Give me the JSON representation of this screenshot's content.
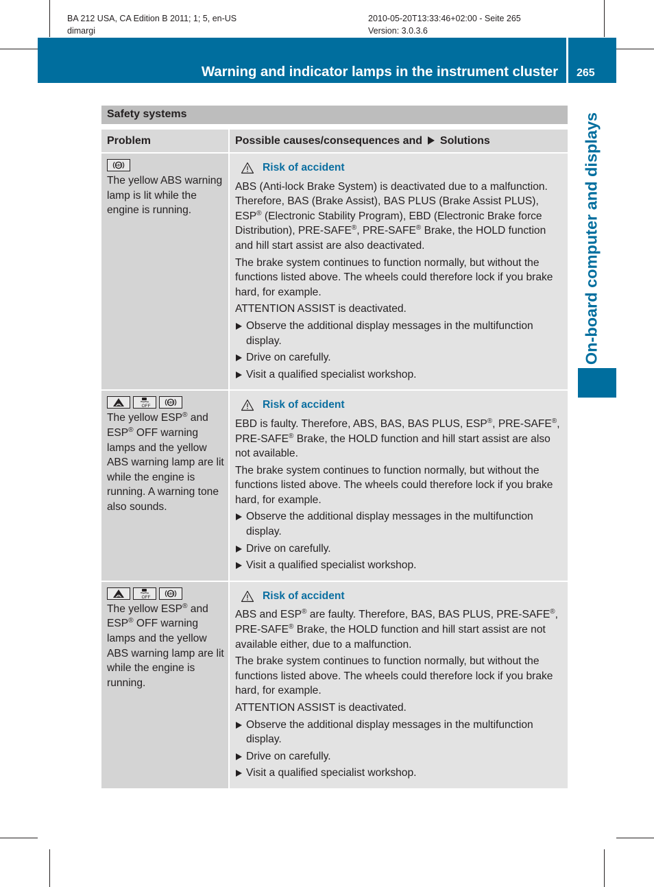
{
  "meta": {
    "left_line1": "BA 212 USA, CA Edition B 2011; 1; 5, en-US",
    "left_line2": "dimargi",
    "right_line1": "2010-05-20T13:33:46+02:00 - Seite 265",
    "right_line2": "Version: 3.0.3.6"
  },
  "header": {
    "title": "Warning and indicator lamps in the instrument cluster",
    "page_number": "265"
  },
  "side_tab": {
    "label": "On-board computer and displays"
  },
  "colors": {
    "brand_blue": "#006e9e",
    "warning_title": "#0a6ea0",
    "section_gray": "#bdbdbd"
  },
  "section": {
    "title": "Safety systems"
  },
  "table": {
    "headers": {
      "problem": "Problem",
      "causes_prefix": "Possible causes/consequences and",
      "causes_suffix": "Solutions"
    },
    "rows": [
      {
        "icons": [
          "abs-lamp"
        ],
        "problem": [
          {
            "t": "The yellow ABS warning lamp is lit while the engine is running."
          }
        ],
        "warning": "Risk of accident",
        "paragraphs": [
          [
            {
              "t": "ABS (Anti-lock Brake System) is deactivated due to a malfunction. Therefore, BAS (Brake Assist), BAS PLUS (Brake Assist PLUS), ESP"
            },
            {
              "sup": "®"
            },
            {
              "t": " (Electronic Stability Program), EBD (Electronic Brake force Distribution), PRE-SAFE"
            },
            {
              "sup": "®"
            },
            {
              "t": ", PRE-SAFE"
            },
            {
              "sup": "®"
            },
            {
              "t": " Brake, the HOLD function and hill start assist are also deactivated."
            }
          ],
          [
            {
              "t": "The brake system continues to function normally, but without the functions listed above. The wheels could therefore lock if you brake hard, for example."
            }
          ],
          [
            {
              "t": "ATTENTION ASSIST is deactivated."
            }
          ]
        ],
        "steps": [
          "Observe the additional display messages in the multifunction display.",
          "Drive on carefully.",
          "Visit a qualified specialist workshop."
        ]
      },
      {
        "icons": [
          "esp-lamp",
          "esp-off-lamp",
          "abs-lamp"
        ],
        "problem": [
          {
            "t": "The yellow ESP"
          },
          {
            "sup": "®"
          },
          {
            "t": " and ESP"
          },
          {
            "sup": "®"
          },
          {
            "t": " OFF warning lamps and the yellow ABS warning lamp are lit while the engine is running. A warning tone also sounds."
          }
        ],
        "warning": "Risk of accident",
        "paragraphs": [
          [
            {
              "t": "EBD is faulty. Therefore, ABS, BAS, BAS PLUS, ESP"
            },
            {
              "sup": "®"
            },
            {
              "t": ", PRE-SAFE"
            },
            {
              "sup": "®"
            },
            {
              "t": ", PRE-SAFE"
            },
            {
              "sup": "®"
            },
            {
              "t": " Brake, the HOLD function and hill start assist are also not available."
            }
          ],
          [
            {
              "t": "The brake system continues to function normally, but without the functions listed above. The wheels could therefore lock if you brake hard, for example."
            }
          ]
        ],
        "steps": [
          "Observe the additional display messages in the multifunction display.",
          "Drive on carefully.",
          "Visit a qualified specialist workshop."
        ]
      },
      {
        "icons": [
          "esp-lamp",
          "esp-off-lamp",
          "abs-lamp"
        ],
        "problem": [
          {
            "t": "The yellow ESP"
          },
          {
            "sup": "®"
          },
          {
            "t": " and ESP"
          },
          {
            "sup": "®"
          },
          {
            "t": " OFF warning lamps and the yellow ABS warning lamp are lit while the engine is running."
          }
        ],
        "warning": "Risk of accident",
        "paragraphs": [
          [
            {
              "t": "ABS and ESP"
            },
            {
              "sup": "®"
            },
            {
              "t": " are faulty. Therefore, BAS, BAS PLUS, PRE-SAFE"
            },
            {
              "sup": "®"
            },
            {
              "t": ", PRE-SAFE"
            },
            {
              "sup": "®"
            },
            {
              "t": " Brake, the HOLD function and hill start assist are not available either, due to a malfunction."
            }
          ],
          [
            {
              "t": "The brake system continues to function normally, but without the functions listed above. The wheels could therefore lock if you brake hard, for example."
            }
          ],
          [
            {
              "t": "ATTENTION ASSIST is deactivated."
            }
          ]
        ],
        "steps": [
          "Observe the additional display messages in the multifunction display.",
          "Drive on carefully.",
          "Visit a qualified specialist workshop."
        ]
      }
    ]
  }
}
